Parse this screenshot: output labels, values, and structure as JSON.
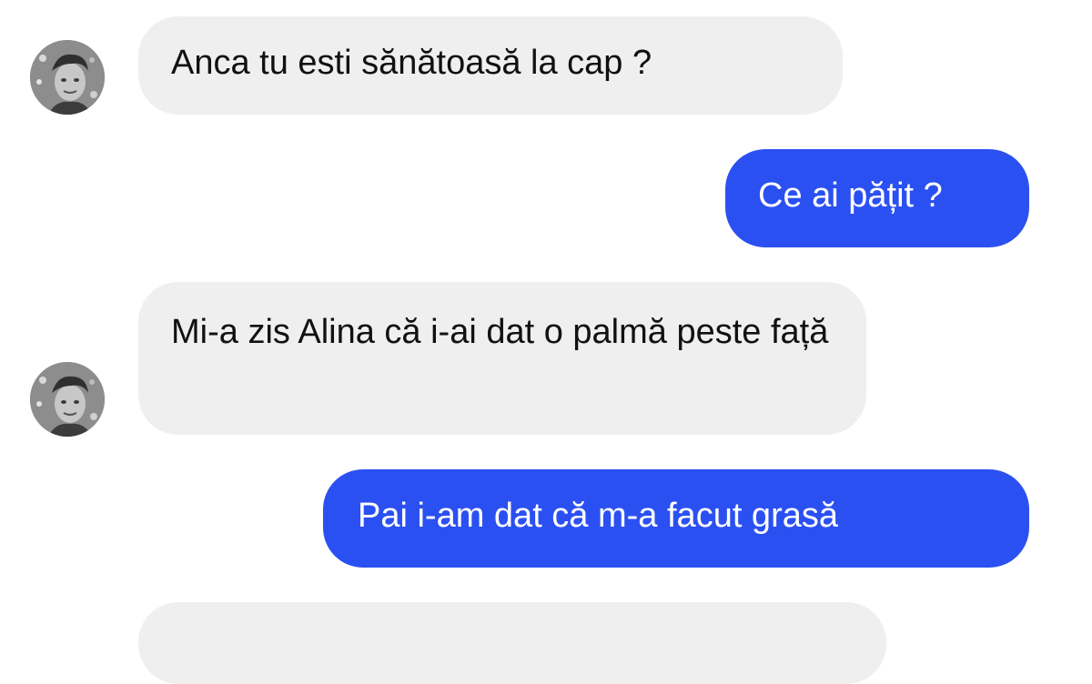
{
  "conversation": {
    "messages": [
      {
        "direction": "incoming",
        "text": "Anca tu esti sănătoasă la cap ?"
      },
      {
        "direction": "outgoing",
        "text": "Ce ai pățit ?"
      },
      {
        "direction": "incoming",
        "text": "Mi-a zis Alina că i-ai dat o palmă peste față"
      },
      {
        "direction": "outgoing",
        "text": "Pai i-am dat că m-a facut grasă"
      },
      {
        "direction": "incoming",
        "text": ""
      }
    ]
  },
  "colors": {
    "incoming_bubble": "#efefef",
    "outgoing_bubble": "#2b50f2",
    "incoming_text": "#111111",
    "outgoing_text": "#ffffff"
  },
  "icons": {
    "contact_avatar": "contact-avatar-photo"
  }
}
